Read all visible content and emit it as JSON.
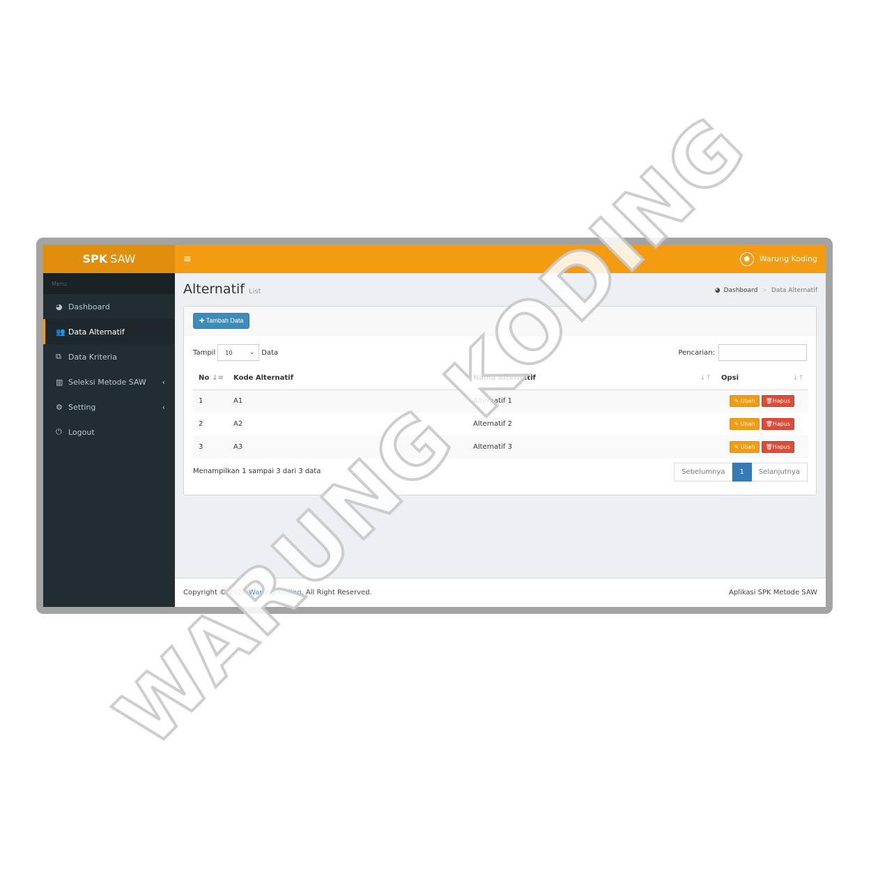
{
  "sidebar": {
    "brand_bold": "SPK",
    "brand_rest": "SAW",
    "menu_header": "Menu",
    "items": [
      {
        "label": "Dashboard",
        "icon": "dashboard-icon"
      },
      {
        "label": "Data Alternatif",
        "icon": "users-icon"
      },
      {
        "label": "Data Kriteria",
        "icon": "cubes-icon"
      },
      {
        "label": "Seleksi Metode SAW",
        "icon": "bar-chart-icon"
      },
      {
        "label": "Setting",
        "icon": "gear-icon"
      },
      {
        "label": "Logout",
        "icon": "power-icon"
      }
    ]
  },
  "topbar": {
    "user_name": "Warung Koding"
  },
  "page": {
    "title": "Alternatif",
    "subtitle": "List",
    "breadcrumb": [
      "Dashboard",
      "Data Alternatif"
    ]
  },
  "box": {
    "add_button": "Tambah Data",
    "show_label": "Tampil",
    "show_value": "10",
    "show_suffix": "Data",
    "search_label": "Pencarian:",
    "search_value": ""
  },
  "table": {
    "headers": [
      "No",
      "Kode Alternatif",
      "Nama Alternatif",
      "Opsi"
    ],
    "rows": [
      {
        "no": "1",
        "kode": "A1",
        "nama": "Alternatif 1"
      },
      {
        "no": "2",
        "kode": "A2",
        "nama": "Alternatif 2"
      },
      {
        "no": "3",
        "kode": "A3",
        "nama": "Alternatif 3"
      }
    ],
    "edit_label": "Ubah",
    "delete_label": "Hapus"
  },
  "pagination": {
    "info": "Menampilkan 1 sampai 3 dari 3 data",
    "prev": "Sebelumnya",
    "current": "1",
    "next": "Selanjutnya"
  },
  "footer": {
    "copyright_prefix": "Copyright © 2024",
    "copyright_link": "Warung Koding",
    "copyright_suffix": ". All Right Reserved.",
    "right_text": "Aplikasi SPK Metode SAW"
  },
  "watermark": "WARUNG KODING",
  "colors": {
    "accent": "#f39c12",
    "accent_dark": "#e08e0b",
    "sidebar": "#222d32",
    "primary": "#3c8dbc",
    "danger": "#dd4b39"
  }
}
